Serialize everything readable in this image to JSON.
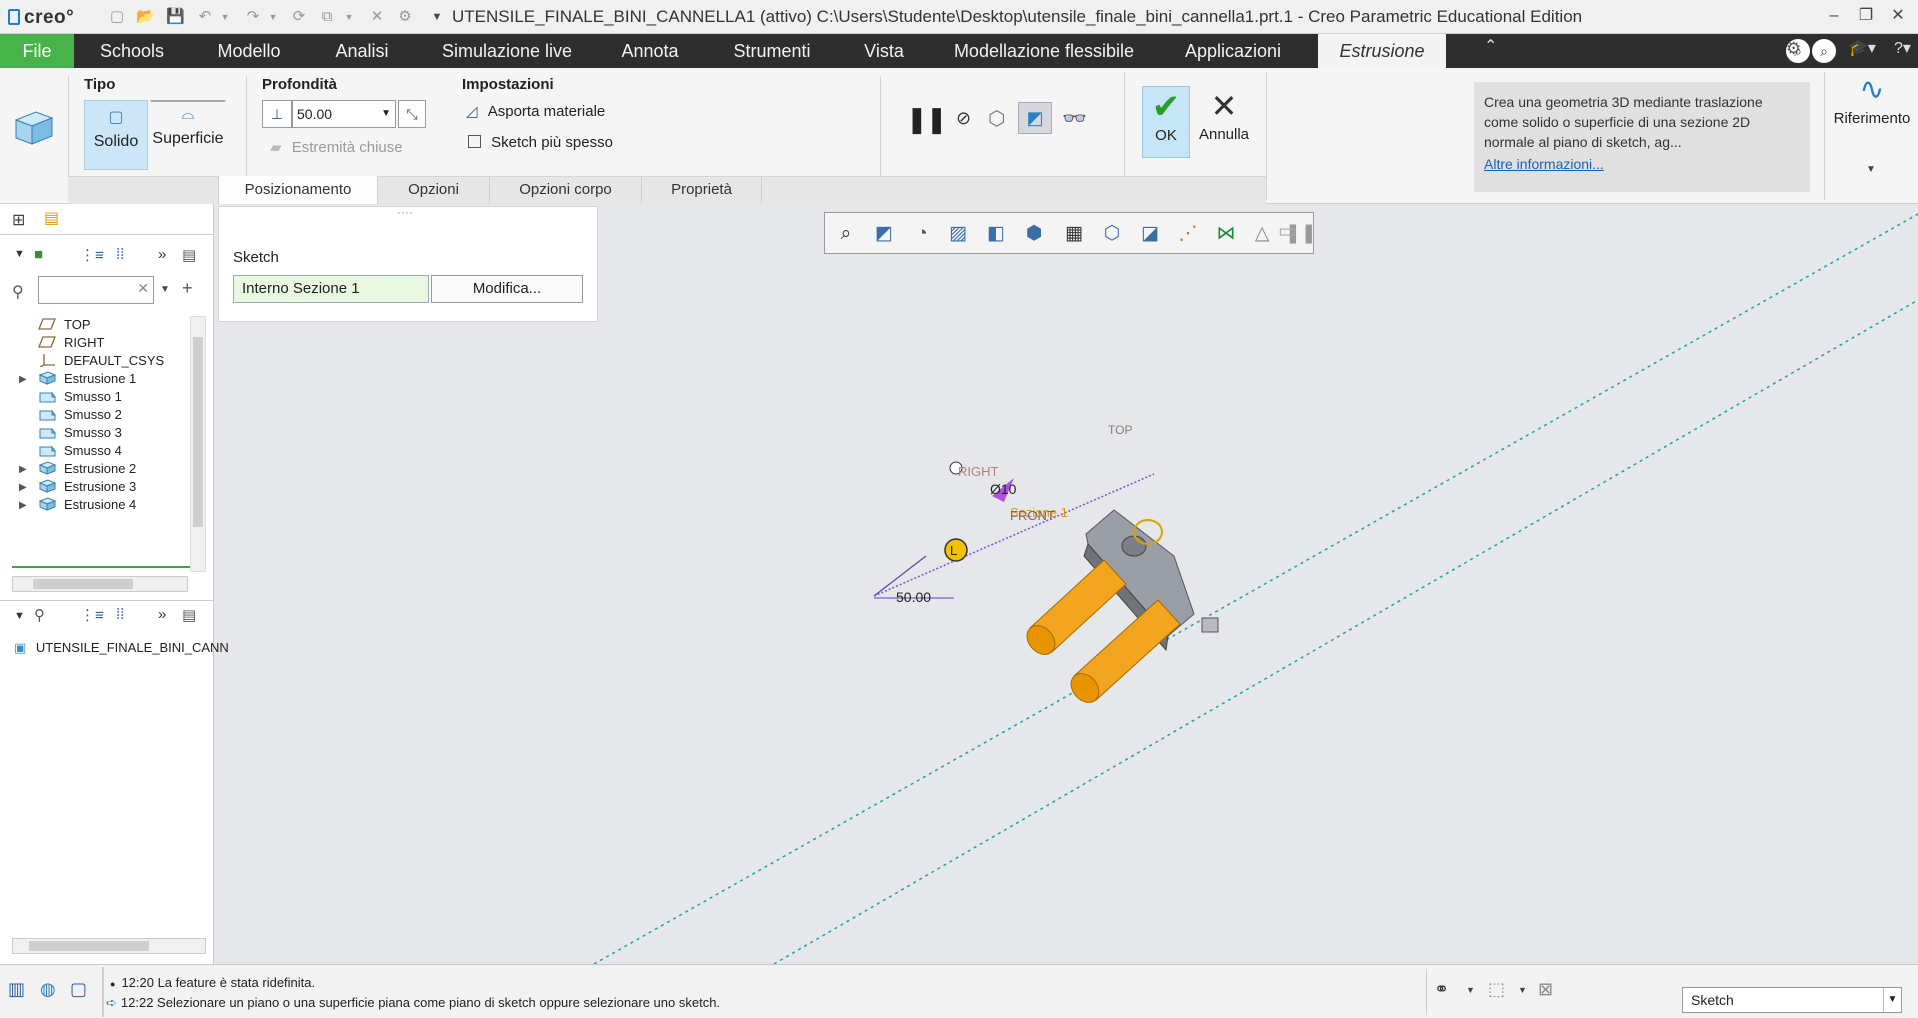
{
  "titlebar": {
    "logo": "creo",
    "title": "UTENSILE_FINALE_BINI_CANNELLA1 (attivo) C:\\Users\\Studente\\Desktop\\utensile_finale_bini_cannella1.prt.1 - Creo Parametric Educational Edition"
  },
  "menu": {
    "file": "File",
    "items": [
      "Schools",
      "Modello",
      "Analisi",
      "Simulazione live",
      "Annota",
      "Strumenti",
      "Vista",
      "Modellazione flessibile",
      "Applicazioni"
    ],
    "active_tab": "Estrusione"
  },
  "ribbon": {
    "tipo_label": "Tipo",
    "solido": "Solido",
    "superficie": "Superficie",
    "profondita_label": "Profondità",
    "depth_value": "50.00",
    "estremita_chiuse": "Estremità chiuse",
    "impostazioni_label": "Impostazioni",
    "asporta_materiale": "Asporta materiale",
    "sketch_spesso": "Sketch più spesso",
    "ok": "OK",
    "annulla": "Annulla",
    "help_text": "Crea una geometria 3D mediante traslazione come solido o superficie di una sezione 2D normale al piano di sketch, ag...",
    "help_link": "Altre informazioni...",
    "riferimento": "Riferimento"
  },
  "subtabs": [
    "Posizionamento",
    "Opzioni",
    "Opzioni corpo",
    "Proprietà"
  ],
  "placement": {
    "sketch_label": "Sketch",
    "sketch_value": "Interno Sezione 1",
    "modifica": "Modifica..."
  },
  "model_tree": {
    "items": [
      {
        "label": "TOP",
        "icon": "datum-plane-icon",
        "expandable": false
      },
      {
        "label": "RIGHT",
        "icon": "datum-plane-icon",
        "expandable": false
      },
      {
        "label": "DEFAULT_CSYS",
        "icon": "csys-icon",
        "expandable": false
      },
      {
        "label": "Estrusione 1",
        "icon": "extrude-icon",
        "expandable": true
      },
      {
        "label": "Smusso 1",
        "icon": "chamfer-icon",
        "expandable": false
      },
      {
        "label": "Smusso 2",
        "icon": "chamfer-icon",
        "expandable": false
      },
      {
        "label": "Smusso 3",
        "icon": "chamfer-icon",
        "expandable": false
      },
      {
        "label": "Smusso 4",
        "icon": "chamfer-icon",
        "expandable": false
      },
      {
        "label": "Estrusione 2",
        "icon": "extrude-icon",
        "expandable": true
      },
      {
        "label": "Estrusione 3",
        "icon": "extrude-icon",
        "expandable": true
      },
      {
        "label": "Estrusione 4",
        "icon": "extrude-icon",
        "expandable": true
      }
    ],
    "lower_item": "UTENSILE_FINALE_BINI_CANN"
  },
  "viewport": {
    "dim_depth": "50.00",
    "dim_diameter": "Ø10",
    "label_right": "RIGHT",
    "label_front": "FRONT",
    "label_top": "TOP",
    "label_section": "Sezione 1",
    "colors": {
      "cylinder": "#f2a51e",
      "body": "#8a8f99",
      "datum_line": "#1aa3a3",
      "dim_line": "#7a4fd8"
    }
  },
  "status": {
    "messages": [
      "12:20 La feature è stata ridefinita.",
      "12:22 Selezionare un piano o una superficie piana come piano di sketch oppure selezionare uno sketch."
    ],
    "filter_value": "Sketch"
  }
}
